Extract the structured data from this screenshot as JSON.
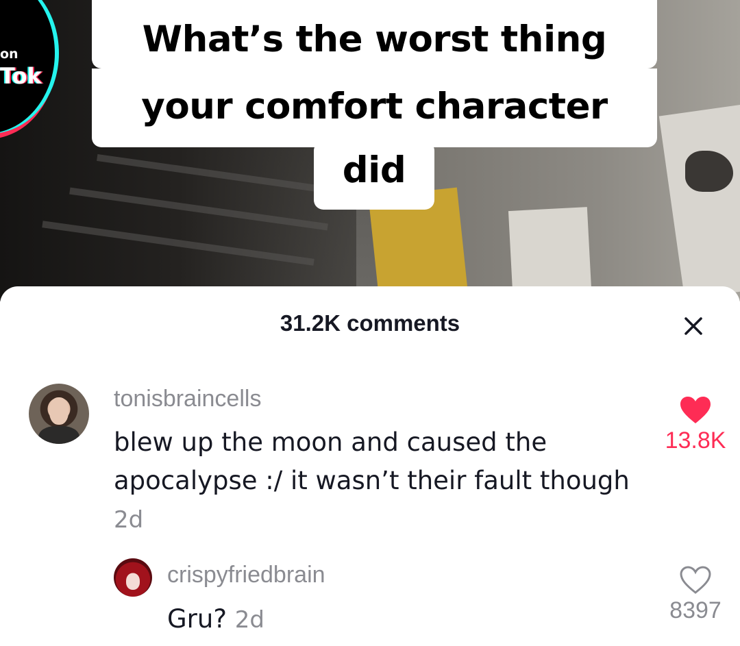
{
  "watermark": {
    "line1": "on",
    "line2": "Tok"
  },
  "caption": {
    "line1": "What’s the worst thing",
    "line2": "your comfort character",
    "line3": "did"
  },
  "comments_sheet": {
    "title": "31.2K comments",
    "close_icon": "close-icon",
    "comments": [
      {
        "username": "tonisbraincells",
        "text": "blew up the moon and caused the apocalypse :/ it wasn’t their fault though",
        "age": "2d",
        "likes": "13.8K",
        "liked": true
      },
      {
        "username": "crispyfriedbrain",
        "text": "Gru?",
        "age": "2d",
        "likes": "8397",
        "liked": false
      }
    ]
  },
  "colors": {
    "like_active": "#fe2c55",
    "muted_text": "#8a8b91",
    "primary_text": "#161823"
  }
}
